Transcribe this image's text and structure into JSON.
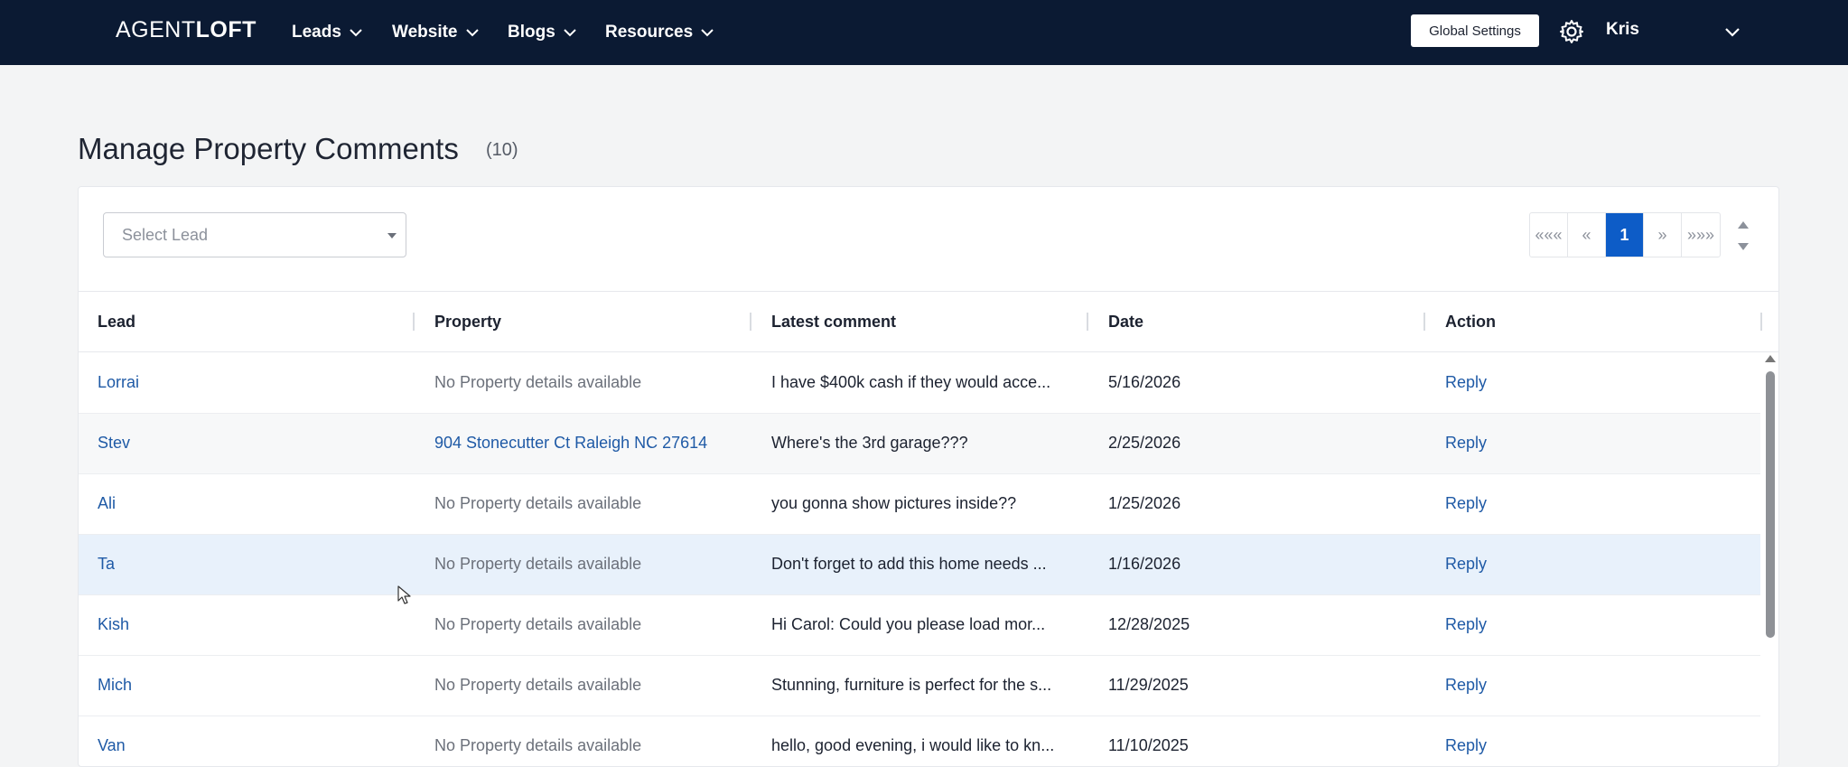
{
  "nav": {
    "brand_light": "AGENT",
    "brand_bold": "LOFT",
    "items": [
      {
        "label": "Leads"
      },
      {
        "label": "Website"
      },
      {
        "label": "Blogs"
      },
      {
        "label": "Resources"
      }
    ],
    "global_settings_label": "Global Settings",
    "user_name": "Kris"
  },
  "page": {
    "title": "Manage Property Comments",
    "count": "(10)"
  },
  "filter": {
    "select_lead_placeholder": "Select Lead"
  },
  "pagination": {
    "first": "«««",
    "prev": "«",
    "current": "1",
    "next": "»",
    "last": "»»»"
  },
  "table": {
    "columns": [
      "Lead",
      "Property",
      "Latest comment",
      "Date",
      "Action"
    ],
    "rows": [
      {
        "lead": "Lorrai",
        "property": "No Property details available",
        "comment": "I have $400k cash if they would acce...",
        "date": "5/16/2026",
        "action": "Reply"
      },
      {
        "lead": "Stev",
        "property": "904 Stonecutter Ct Raleigh NC 27614",
        "comment": "Where's the 3rd garage???",
        "date": "2/25/2026",
        "action": "Reply"
      },
      {
        "lead": "Ali",
        "property": "No Property details available",
        "comment": "you gonna show pictures inside??",
        "date": "1/25/2026",
        "action": "Reply"
      },
      {
        "lead": "Ta",
        "property": "No Property details available",
        "comment": "Don't forget to add this home needs ...",
        "date": "1/16/2026",
        "action": "Reply"
      },
      {
        "lead": "Kish",
        "property": "No Property details available",
        "comment": "Hi Carol: Could you please load mor...",
        "date": "12/28/2025",
        "action": "Reply"
      },
      {
        "lead": "Mich",
        "property": "No Property details available",
        "comment": "Stunning, furniture is perfect for the s...",
        "date": "11/29/2025",
        "action": "Reply"
      },
      {
        "lead": "Van",
        "property": "No Property details available",
        "comment": "hello, good evening, i would like to kn...",
        "date": "11/10/2025",
        "action": "Reply"
      }
    ]
  },
  "colors": {
    "nav_bg": "#0b1a33",
    "accent": "#0d5cc7",
    "link": "#1f5aa6",
    "row_hover": "#e8f1fb"
  }
}
